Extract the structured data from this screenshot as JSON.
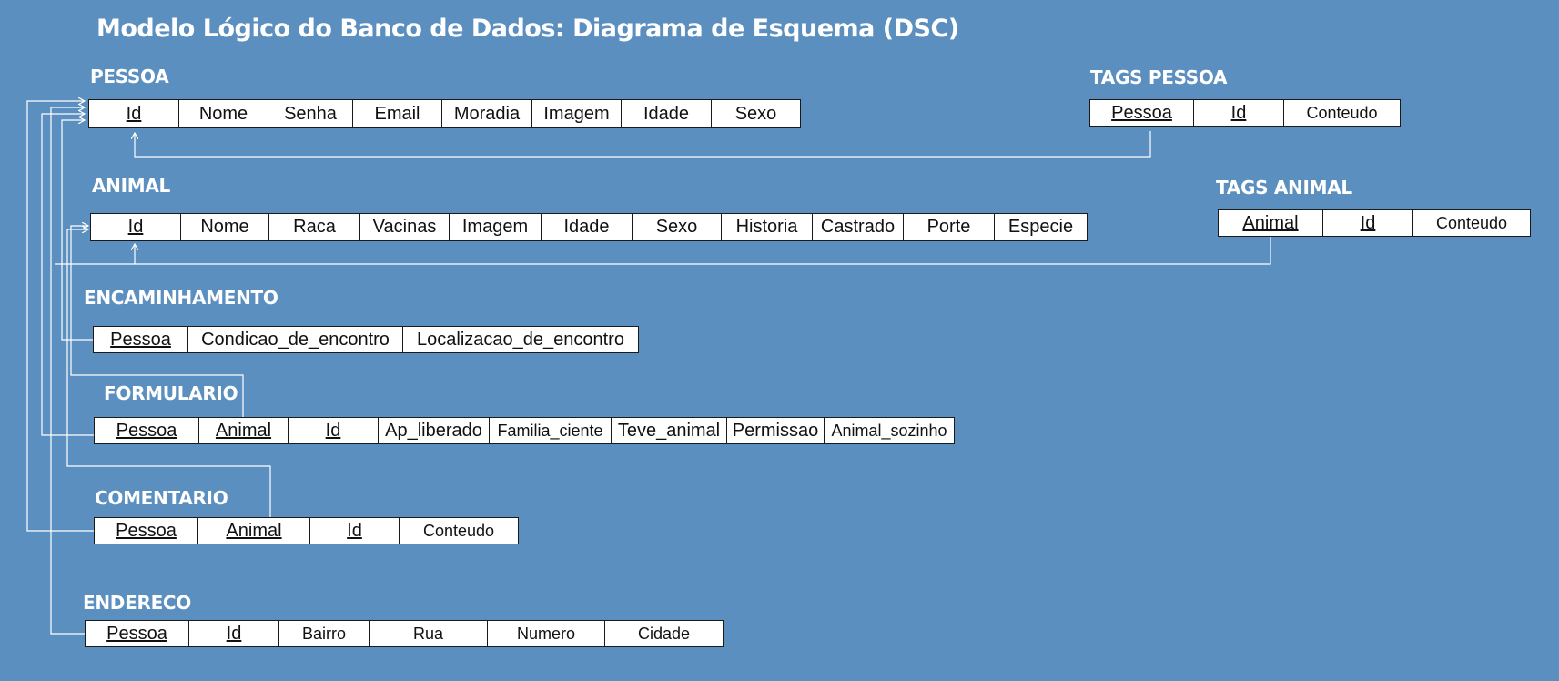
{
  "title": "Modelo Lógico do Banco de Dados: Diagrama de Esquema (DSC)",
  "tables": {
    "pessoa": {
      "name": "PESSOA",
      "cols": [
        "Id",
        "Nome",
        "Senha",
        "Email",
        "Moradia",
        "Imagem",
        "Idade",
        "Sexo"
      ]
    },
    "tags_pessoa": {
      "name": "TAGS PESSOA",
      "cols": [
        "Pessoa",
        "Id",
        "Conteudo"
      ]
    },
    "animal": {
      "name": "ANIMAL",
      "cols": [
        "Id",
        "Nome",
        "Raca",
        "Vacinas",
        "Imagem",
        "Idade",
        "Sexo",
        "Historia",
        "Castrado",
        "Porte",
        "Especie"
      ]
    },
    "tags_animal": {
      "name": "TAGS ANIMAL",
      "cols": [
        "Animal",
        "Id",
        "Conteudo"
      ]
    },
    "encaminhamento": {
      "name": "ENCAMINHAMENTO",
      "cols": [
        "Pessoa",
        "Condicao_de_encontro",
        "Localizacao_de_encontro"
      ]
    },
    "formulario": {
      "name": "FORMULARIO",
      "cols": [
        "Pessoa",
        "Animal",
        "Id",
        "Ap_liberado",
        "Familia_ciente",
        "Teve_animal",
        "Permissao",
        "Animal_sozinho"
      ]
    },
    "comentario": {
      "name": "COMENTARIO",
      "cols": [
        "Pessoa",
        "Animal",
        "Id",
        "Conteudo"
      ]
    },
    "endereco": {
      "name": "ENDERECO",
      "cols": [
        "Pessoa",
        "Id",
        "Bairro",
        "Rua",
        "Numero",
        "Cidade"
      ]
    }
  },
  "colors": {
    "background": "#5b8fbf",
    "cell": "#ffffff",
    "lines": "#ffffff"
  }
}
